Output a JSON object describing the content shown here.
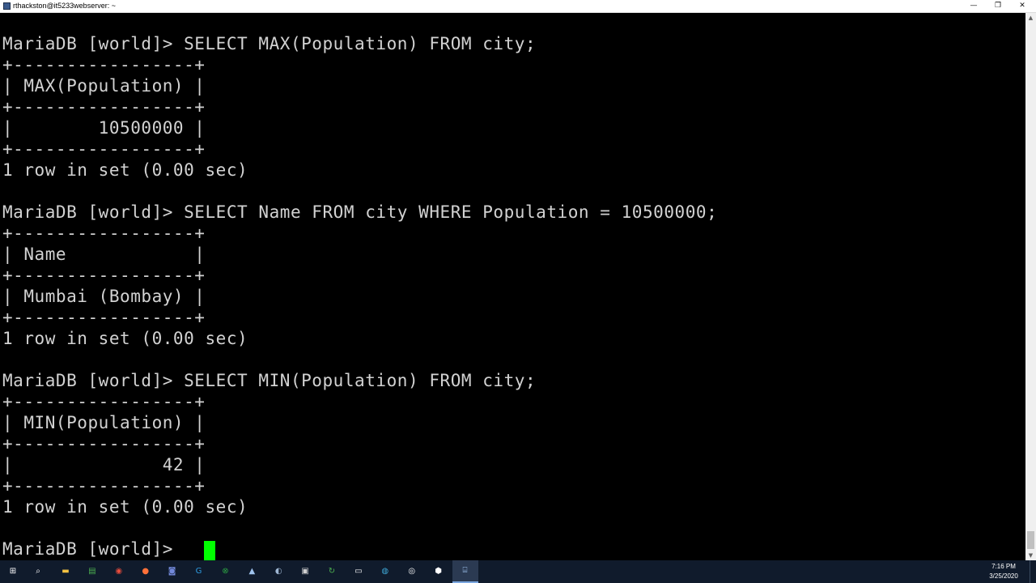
{
  "window": {
    "title": "rthackston@it5233webserver: ~",
    "minimize": "—",
    "restore": "❐",
    "close": "✕"
  },
  "terminal": {
    "lines": [
      "MariaDB [world]> SELECT MAX(Population) FROM city;",
      "+-----------------+",
      "| MAX(Population) |",
      "+-----------------+",
      "|        10500000 |",
      "+-----------------+",
      "1 row in set (0.00 sec)",
      "",
      "MariaDB [world]> SELECT Name FROM city WHERE Population = 10500000;",
      "+-----------------+",
      "| Name            |",
      "+-----------------+",
      "| Mumbai (Bombay) |",
      "+-----------------+",
      "1 row in set (0.00 sec)",
      "",
      "MariaDB [world]> SELECT MIN(Population) FROM city;",
      "+-----------------+",
      "| MIN(Population) |",
      "+-----------------+",
      "|              42 |",
      "+-----------------+",
      "1 row in set (0.00 sec)",
      "",
      "MariaDB [world]> "
    ],
    "cursor_color": "#00ff00",
    "text_color": "#d2d2d2",
    "background": "#000000"
  },
  "scrollbar": {
    "up_arrow": "▲",
    "down_arrow": "▼"
  },
  "taskbar": {
    "items": [
      {
        "name": "windows-start-icon",
        "glyph": "⊞",
        "color": "#ffffff"
      },
      {
        "name": "search-icon",
        "glyph": "⌕",
        "color": "#ffffff"
      },
      {
        "name": "file-explorer-icon",
        "glyph": "▬",
        "color": "#f4c242"
      },
      {
        "name": "notepad-icon",
        "glyph": "▤",
        "color": "#4caf50"
      },
      {
        "name": "chrome-icon",
        "glyph": "◉",
        "color": "#e74c3c"
      },
      {
        "name": "firefox-icon",
        "glyph": "●",
        "color": "#ff7139"
      },
      {
        "name": "discord-icon",
        "glyph": "◙",
        "color": "#7289da"
      },
      {
        "name": "g-app-icon",
        "glyph": "G",
        "color": "#2e9be0"
      },
      {
        "name": "xbox-icon",
        "glyph": "⊗",
        "color": "#2ca243"
      },
      {
        "name": "arduino-icon",
        "glyph": "▲",
        "color": "#9fc3ee"
      },
      {
        "name": "steam-icon",
        "glyph": "◐",
        "color": "#9fb7d3"
      },
      {
        "name": "printer-icon",
        "glyph": "▣",
        "color": "#d0d0d0"
      },
      {
        "name": "refresh-app-icon",
        "glyph": "↻",
        "color": "#4caf50"
      },
      {
        "name": "remote-desktop-icon",
        "glyph": "▭",
        "color": "#ffffff"
      },
      {
        "name": "globe-icon",
        "glyph": "◍",
        "color": "#3fa7d6"
      },
      {
        "name": "obs-icon",
        "glyph": "◎",
        "color": "#ffffff"
      },
      {
        "name": "maps-pin-icon",
        "glyph": "⬢",
        "color": "#ffffff"
      },
      {
        "name": "putty-icon",
        "glyph": "⌸",
        "color": "#9fc3ee"
      }
    ],
    "active_index": 17,
    "clock_time": "7:16 PM",
    "clock_date": "3/25/2020"
  }
}
